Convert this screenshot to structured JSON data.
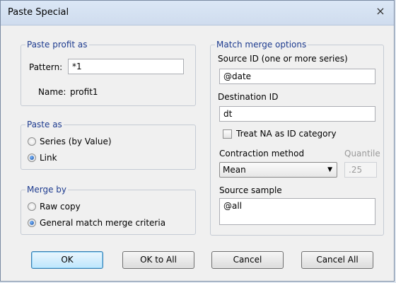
{
  "window": {
    "title": "Paste Special",
    "close_icon": "×"
  },
  "paste_profit": {
    "legend": "Paste profit as",
    "pattern_label": "Pattern:",
    "pattern_value": "*1",
    "name_label": "Name:",
    "name_value": "profit1"
  },
  "paste_as": {
    "legend": "Paste as",
    "options": [
      "Series (by Value)",
      "Link"
    ],
    "selected": "Link"
  },
  "merge_by": {
    "legend": "Merge by",
    "options": [
      "Raw copy",
      "General match merge criteria"
    ],
    "selected": "General match merge criteria"
  },
  "match_merge": {
    "legend": "Match merge options",
    "source_id_label": "Source ID (one or more series)",
    "source_id_value": "@date",
    "dest_id_label": "Destination ID",
    "dest_id_value": "dt",
    "treat_na_label": "Treat NA as ID category",
    "treat_na_checked": false,
    "contraction_label": "Contraction method",
    "contraction_value": "Mean",
    "quantile_label": "Quantile",
    "quantile_value": ".25",
    "source_sample_label": "Source sample",
    "source_sample_value": "@all"
  },
  "buttons": {
    "ok": "OK",
    "ok_all": "OK to All",
    "cancel": "Cancel",
    "cancel_all": "Cancel All"
  }
}
